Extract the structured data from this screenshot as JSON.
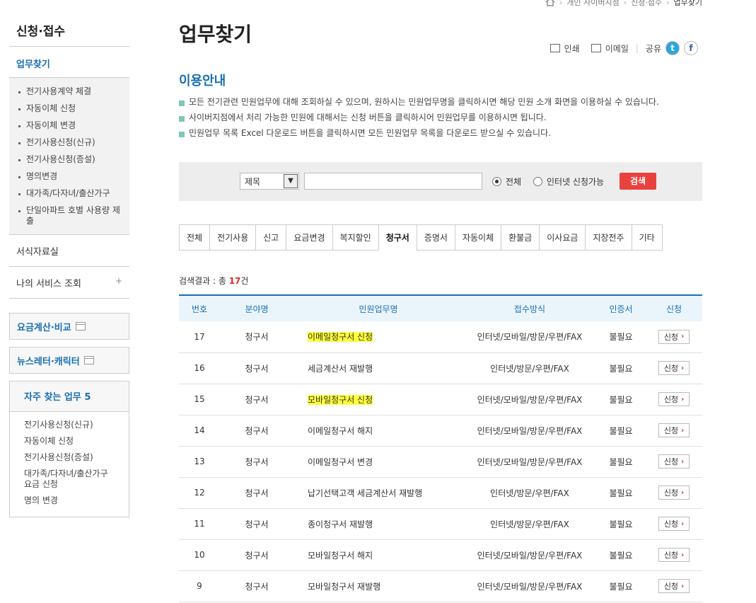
{
  "breadcrumb": [
    "개인 사이버지점",
    "신청·접수",
    "업무찾기"
  ],
  "sidebar": {
    "title": "신청·접수",
    "sub": "업무찾기",
    "items": [
      "전기사용계약 체결",
      "자동이체 신청",
      "자동이체 변경",
      "전기사용신청(신규)",
      "전기사용신청(증설)",
      "명의변경",
      "대가족/다자녀/출산가구",
      "단일아파트 호별 사용량 제출"
    ],
    "links": [
      "서식자료실",
      "나의 서비스 조회"
    ],
    "plus": "+",
    "boxes": [
      "요금계산·비교",
      "뉴스레터·캐릭터"
    ],
    "freq_title": "자주 찾는 업무 5",
    "freq_items": [
      "전기사용신청(신규)",
      "자동이체 신청",
      "전기사용신청(증설)",
      "대가족/다자녀/출산가구 요금 신청",
      "명의 변경"
    ]
  },
  "main": {
    "title": "업무찾기",
    "tools": {
      "print": "인쇄",
      "email": "이메일",
      "share": "공유",
      "twitter": "t",
      "facebook": "f"
    },
    "section_title": "이용안내",
    "guide": [
      "모든 전기관련 민원업무에 대해 조회하실 수 있으며, 원하시는 민원업무명을 클릭하시면 해당 민원 소개 화면을 이용하실 수 있습니다.",
      "사이버지점에서 처리 가능한 민원에 대해서는 신청 버튼을 클릭하시어 민원업무를 이용하시면 됩니다.",
      "민원업무 목록 Excel 다운로드 버튼을 클릭하시면 모든 민원업무 목록을 다운로드 받으실 수 있습니다."
    ],
    "search": {
      "select_value": "제목",
      "radio_all": "전체",
      "radio_online": "인터넷 신청가능",
      "button": "검색"
    },
    "tabs": [
      "전체",
      "전기사용",
      "신고",
      "요금변경",
      "복지할인",
      "청구서",
      "증명서",
      "자동이체",
      "환불금",
      "이사요금",
      "지장전주",
      "기타"
    ],
    "result_prefix": "검색결과 : 총 ",
    "result_count": "17",
    "result_suffix": "건",
    "table": {
      "headers": [
        "번호",
        "분야명",
        "민원업무명",
        "접수방식",
        "인증서",
        "신청"
      ],
      "apply_label": "신청",
      "rows": [
        {
          "no": "17",
          "field": "청구서",
          "name": "이메일청구서 신청",
          "method": "인터넷/모바일/방문/우편/FAX",
          "cert": "불필요",
          "highlight": true
        },
        {
          "no": "16",
          "field": "청구서",
          "name": "세금계산서 재발행",
          "method": "인터넷/방문/우편/FAX",
          "cert": "불필요",
          "highlight": false
        },
        {
          "no": "15",
          "field": "청구서",
          "name": "모바일청구서 신청",
          "method": "인터넷/모바일/방문/우편/FAX",
          "cert": "불필요",
          "highlight": true
        },
        {
          "no": "14",
          "field": "청구서",
          "name": "이메일청구서 해지",
          "method": "인터넷/모바일/방문/우편/FAX",
          "cert": "불필요",
          "highlight": false
        },
        {
          "no": "13",
          "field": "청구서",
          "name": "이메일청구서 변경",
          "method": "인터넷/모바일/방문/우편/FAX",
          "cert": "불필요",
          "highlight": false
        },
        {
          "no": "12",
          "field": "청구서",
          "name": "납기선택고객 세금계산서 재발행",
          "method": "인터넷/방문/우편/FAX",
          "cert": "불필요",
          "highlight": false
        },
        {
          "no": "11",
          "field": "청구서",
          "name": "종이청구서 재발행",
          "method": "인터넷/방문/우편/FAX",
          "cert": "불필요",
          "highlight": false
        },
        {
          "no": "10",
          "field": "청구서",
          "name": "모바일청구서 해지",
          "method": "인터넷/모바일/방문/우편/FAX",
          "cert": "불필요",
          "highlight": false
        },
        {
          "no": "9",
          "field": "청구서",
          "name": "모바일청구서 재발행",
          "method": "인터넷/모바일/방문/우편/FAX",
          "cert": "불필요",
          "highlight": false
        }
      ]
    },
    "colors": {
      "accent": "#1a6fb0",
      "search_button": "#e8423f",
      "highlight": "#ffff3a"
    }
  }
}
